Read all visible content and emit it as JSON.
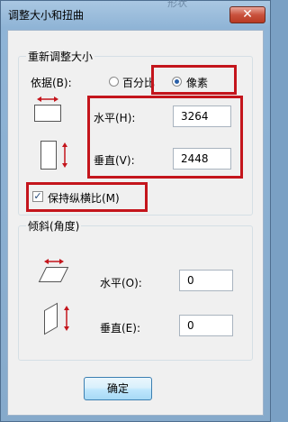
{
  "window": {
    "title": "调整大小和扭曲",
    "close_glyph": "✕",
    "background_fragment": "形状"
  },
  "resize": {
    "group_title": "重新调整大小",
    "basis_label": "依据(B):",
    "percent_label": "百分比",
    "pixels_label": "像素",
    "selected": "像素",
    "horizontal_label": "水平(H):",
    "horizontal_value": "3264",
    "vertical_label": "垂直(V):",
    "vertical_value": "2448",
    "keep_ratio_label": "保持纵横比(M)",
    "keep_ratio_checked": true
  },
  "skew": {
    "group_title": "倾斜(角度)",
    "horizontal_label": "水平(O):",
    "horizontal_value": "0",
    "vertical_label": "垂直(E):",
    "vertical_value": "0"
  },
  "buttons": {
    "ok": "确定"
  },
  "colors": {
    "highlight": "#c4151c",
    "arrow": "#c4151c"
  }
}
